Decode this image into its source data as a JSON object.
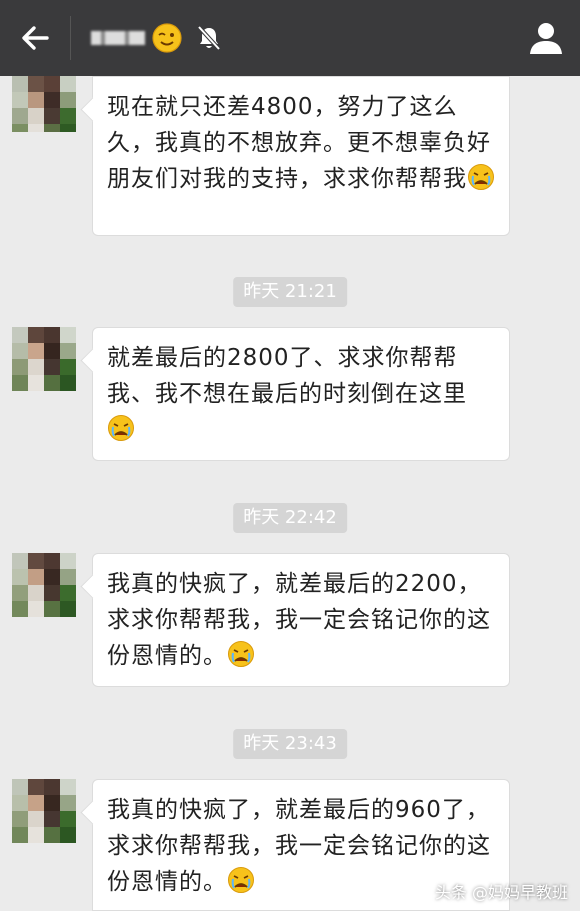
{
  "header": {
    "title_blurred": "",
    "back_icon": "arrow-left-icon",
    "wink_icon": "wink-emoji-icon",
    "mute_icon": "bell-muted-icon",
    "profile_icon": "person-icon"
  },
  "messages": [
    {
      "text": "现在就只还差4800，努力了这么久，我真的不想放弃。更不想辜负好朋友们对我的支持，求求你帮帮我",
      "emoji": "crying-emoji"
    },
    {
      "timestamp": "昨天 21:21"
    },
    {
      "text": "就差最后的2800了、求求你帮帮我、我不想在最后的时刻倒在这里",
      "emoji": "crying-emoji"
    },
    {
      "timestamp": "昨天 22:42"
    },
    {
      "text": "我真的快疯了，就差最后的2200，求求你帮帮我，我一定会铭记你的这份恩情的。",
      "emoji": "crying-emoji"
    },
    {
      "timestamp": "昨天 23:43"
    },
    {
      "text": "我真的快疯了，就差最后的960了，求求你帮帮我，我一定会铭记你的这份恩情的。",
      "emoji": "crying-emoji"
    }
  ],
  "watermark": "头条 @妈妈早教班",
  "colors": {
    "titlebar": "#3a3a3c",
    "background": "#ebebeb",
    "bubble": "#ffffff",
    "timestamp_bg": "#d5d5d5"
  }
}
